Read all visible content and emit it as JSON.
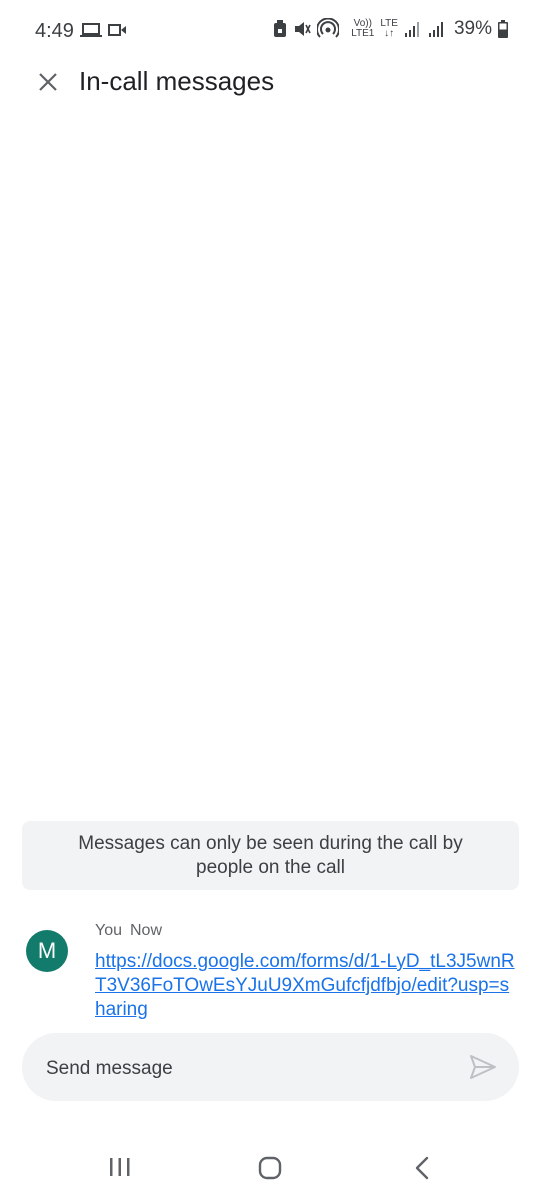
{
  "status_bar": {
    "time": "4:49",
    "network_top": "Vo))",
    "network_bottom": "LTE1",
    "lte_top": "LTE",
    "lte_bottom": "↓↑",
    "battery": "39%"
  },
  "header": {
    "title": "In-call messages"
  },
  "notice": {
    "text": "Messages can only be seen during the call by people on the call"
  },
  "message": {
    "avatar_letter": "M",
    "avatar_color": "#137b6c",
    "sender": "You",
    "time": "Now",
    "link": "https://docs.google.com/forms/d/1-LyD_tL3J5wnRT3V36FoTOwEsYJuU9XmGufcfjdfbjo/edit?usp=sharing",
    "link_color": "#1a73e8"
  },
  "composer": {
    "placeholder": "Send message"
  },
  "icons": {
    "close": "close-icon",
    "send": "send-icon",
    "recents": "recents-icon",
    "home": "home-icon",
    "back": "back-icon"
  }
}
